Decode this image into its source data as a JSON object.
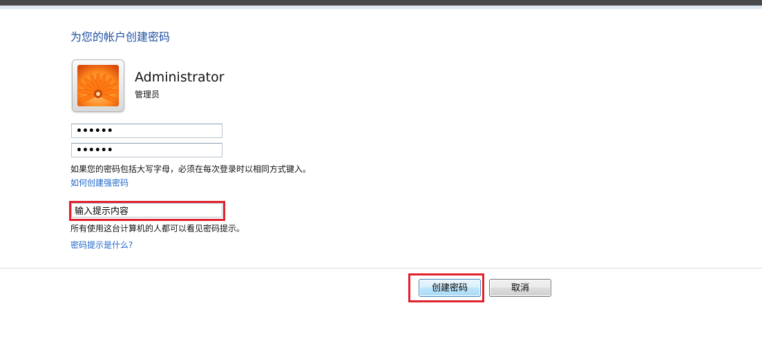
{
  "window": {
    "title": "为您的帐户创建密码"
  },
  "account": {
    "name": "Administrator",
    "role": "管理员",
    "avatar_icon": "orange-flower-icon"
  },
  "password_fields": {
    "new_password_mask": "••••••",
    "confirm_password_mask": "••••••"
  },
  "caps_note": "如果您的密码包括大写字母，必须在每次登录时以相同方式键入。",
  "strong_password_link": "如何创建强密码",
  "hint": {
    "value": "输入提示内容",
    "note": "所有使用这台计算机的人都可以看见密码提示。",
    "link": "密码提示是什么?"
  },
  "buttons": {
    "create": "创建密码",
    "cancel": "取消"
  },
  "colors": {
    "title": "#1e50a2",
    "link": "#1d66c8",
    "highlight": "#e0202a"
  }
}
